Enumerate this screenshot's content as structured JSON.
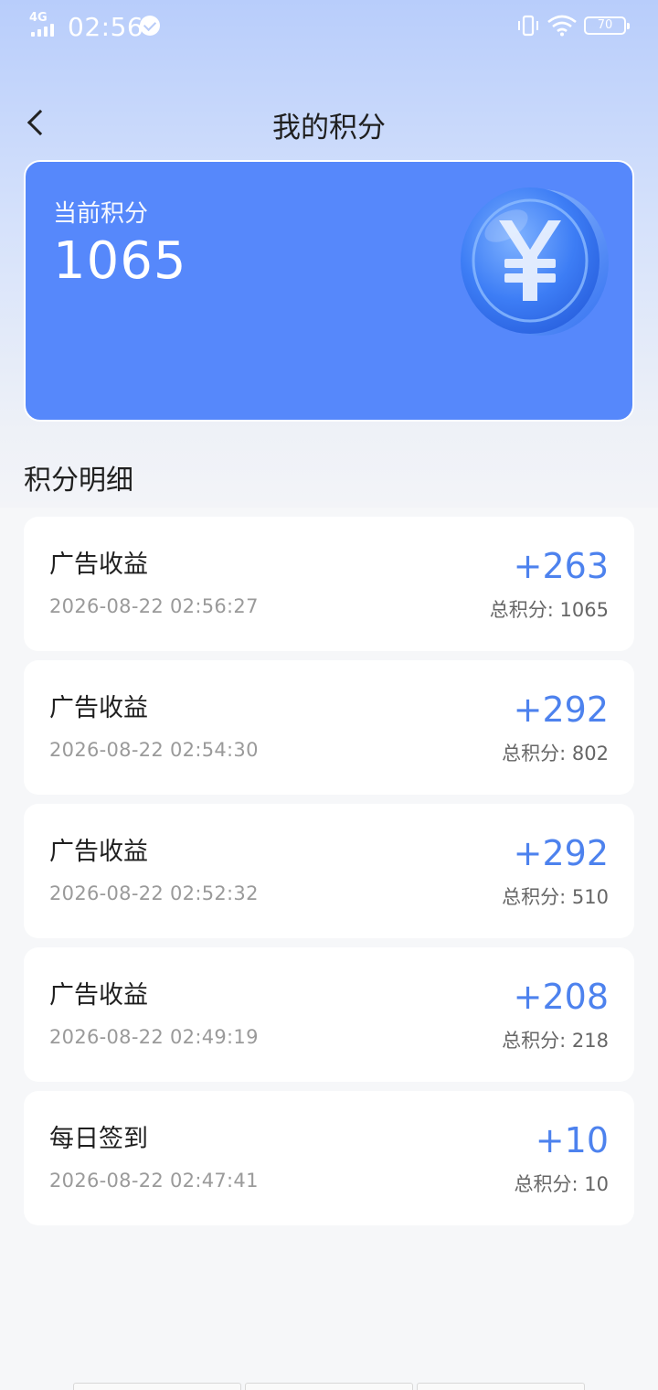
{
  "status_bar": {
    "network": "4G",
    "time": "02:56",
    "battery": "70"
  },
  "nav": {
    "title": "我的积分"
  },
  "points_card": {
    "label": "当前积分",
    "value": "1065",
    "icon": "yuan-coin-icon"
  },
  "details": {
    "title": "积分明细",
    "total_prefix": "总积分: ",
    "records": [
      {
        "title": "广告收益",
        "time": "2026-08-22 02:56:27",
        "amount": "+263",
        "total": "总积分: 1065"
      },
      {
        "title": "广告收益",
        "time": "2026-08-22 02:54:30",
        "amount": "+292",
        "total": "总积分: 802"
      },
      {
        "title": "广告收益",
        "time": "2026-08-22 02:52:32",
        "amount": "+292",
        "total": "总积分: 510"
      },
      {
        "title": "广告收益",
        "time": "2026-08-22 02:49:19",
        "amount": "+208",
        "total": "总积分: 218"
      },
      {
        "title": "每日签到",
        "time": "2026-08-22 02:47:41",
        "amount": "+10",
        "total": "总积分: 10"
      }
    ]
  },
  "colors": {
    "card_blue": "#5688fb",
    "amount_blue": "#4d82ee"
  }
}
